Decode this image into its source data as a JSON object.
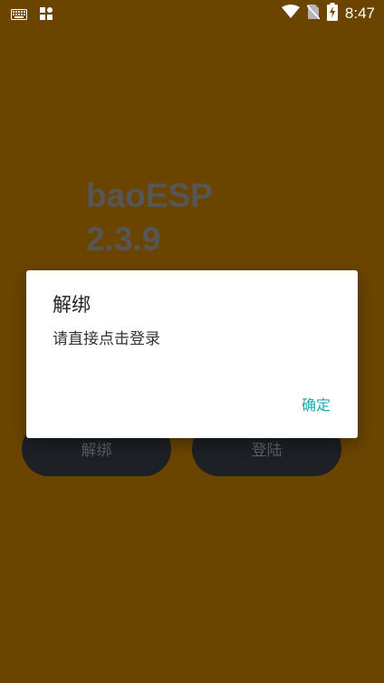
{
  "status_bar": {
    "time": "8:47",
    "icons": [
      "keyboard-icon",
      "app-grid-icon",
      "wifi-icon",
      "no-sim-icon",
      "battery-charging-icon"
    ]
  },
  "app": {
    "title_line1": "baoESP",
    "title_line2": "2.3.9",
    "unbind_button": "解绑",
    "login_button": "登陆"
  },
  "dialog": {
    "title": "解绑",
    "message": "请直接点击登录",
    "confirm": "确定"
  },
  "colors": {
    "background": "#6b4500",
    "accent": "#1aa7b3",
    "pill": "#1d2024"
  }
}
